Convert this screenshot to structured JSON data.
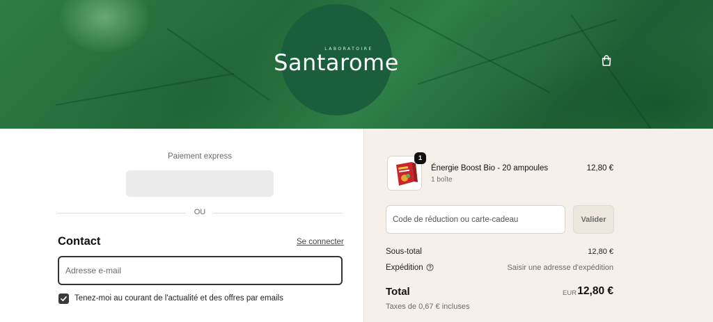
{
  "brand": {
    "name": "Santarome",
    "tagline": "LABORATOIRE",
    "logo_circle_color": "#1b5e3b"
  },
  "header": {
    "cart_icon": "shopping-bag-icon"
  },
  "express": {
    "label": "Paiement express",
    "separator": "OU"
  },
  "contact": {
    "title": "Contact",
    "signin_label": "Se connecter",
    "email_placeholder": "Adresse e-mail",
    "newsletter_label": "Tenez-moi au courant de l'actualité et des offres par emails",
    "newsletter_checked": true
  },
  "order": {
    "item": {
      "name": "Énergie Boost Bio - 20 ampoules",
      "variant": "1 boîte",
      "price": "12,80 €",
      "quantity": "1"
    },
    "discount": {
      "placeholder": "Code de réduction ou carte-cadeau",
      "apply_label": "Valider"
    },
    "subtotal": {
      "label": "Sous-total",
      "value": "12,80 €"
    },
    "shipping": {
      "label": "Expédition",
      "value": "Saisir une adresse d'expédition",
      "icon": "help-circle-icon"
    },
    "total": {
      "label": "Total",
      "currency": "EUR",
      "value": "12,80 €"
    },
    "taxes": "Taxes de 0,67 € incluses"
  },
  "colors": {
    "summary_background": "#f5f0ea",
    "banner_green": "#2a7a44"
  }
}
